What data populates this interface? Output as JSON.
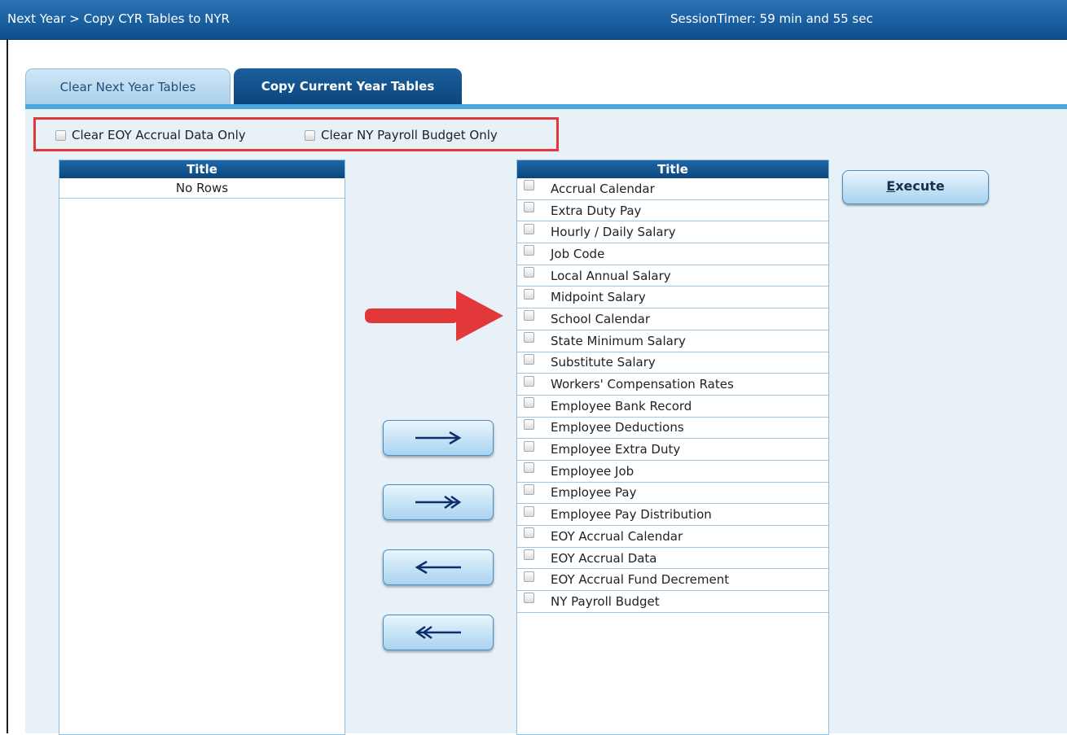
{
  "header": {
    "breadcrumb": "Next Year > Copy CYR Tables to NYR",
    "session_timer": "SessionTimer: 59 min and 55 sec"
  },
  "tabs": [
    {
      "label": "Clear Next Year Tables",
      "active": true
    },
    {
      "label": "Copy Current Year Tables",
      "active": false
    }
  ],
  "options": {
    "clear_eoy_accrual": "Clear EOY Accrual Data Only",
    "clear_ny_payroll": "Clear NY Payroll Budget Only"
  },
  "left_list": {
    "header": "Title",
    "empty_text": "No Rows"
  },
  "right_list": {
    "header": "Title",
    "items": [
      "Accrual Calendar",
      "Extra Duty Pay",
      "Hourly / Daily Salary",
      "Job Code",
      "Local Annual Salary",
      "Midpoint Salary",
      "School Calendar",
      "State Minimum Salary",
      "Substitute Salary",
      "Workers' Compensation Rates",
      "Employee Bank Record",
      "Employee Deductions",
      "Employee Extra Duty",
      "Employee Job",
      "Employee Pay",
      "Employee Pay Distribution",
      "EOY Accrual Calendar",
      "EOY Accrual Data",
      "EOY Accrual Fund Decrement",
      "NY Payroll Budget"
    ]
  },
  "buttons": {
    "execute_first": "E",
    "execute_rest": "xecute",
    "move_icons": [
      "arrow-right-icon",
      "double-arrow-right-icon",
      "arrow-left-icon",
      "double-arrow-left-icon"
    ]
  },
  "colors": {
    "title_bar": "#0c4f8f",
    "active_tab": "#a9d0ec",
    "inactive_tab": "#0c467d",
    "highlight_box": "#e2383a",
    "annotation_arrow": "#e2383a"
  }
}
